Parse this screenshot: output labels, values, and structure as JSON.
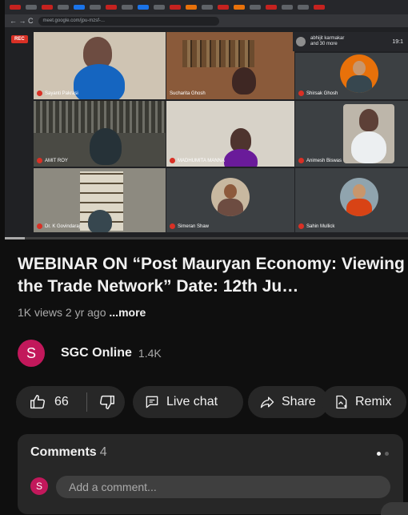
{
  "meeting": {
    "rec_label": "REC",
    "url": "meet.google.com/jpu-mzsf-...",
    "people_summary": "abhijit karmakar and 30 more",
    "time": "19:1",
    "participants": [
      "Sayanti Pakrasi",
      "Sucharita Ghosh",
      "Shirsak Ghosh",
      "AMIT ROY",
      "MADHUMITA MANNA",
      "Animesh Biswas",
      "Dr. K Govindaraj",
      "Simeran Shaw",
      "Sahin Mullick"
    ]
  },
  "player": {
    "progress": 0.05
  },
  "video": {
    "title": "WEBINAR ON “Post Mauryan Economy: Viewing the Trade Network” Date: 12th Ju…",
    "views": "1K views",
    "age": "2 yr ago",
    "more_label": "...more"
  },
  "channel": {
    "avatar_letter": "S",
    "name": "SGC Online",
    "subscribers": "1.4K",
    "avatar_color": "#c2185b"
  },
  "actions": {
    "likes": "66",
    "live_chat_label": "Live chat",
    "share_label": "Share",
    "remix_label": "Remix"
  },
  "comments": {
    "title": "Comments",
    "count": "4",
    "avatar_letter": "S",
    "placeholder": "Add a comment..."
  },
  "icons": {
    "like": "thumbs-up-icon",
    "dislike": "thumbs-down-icon",
    "live_chat": "chat-icon",
    "share": "share-icon",
    "remix": "remix-icon"
  }
}
